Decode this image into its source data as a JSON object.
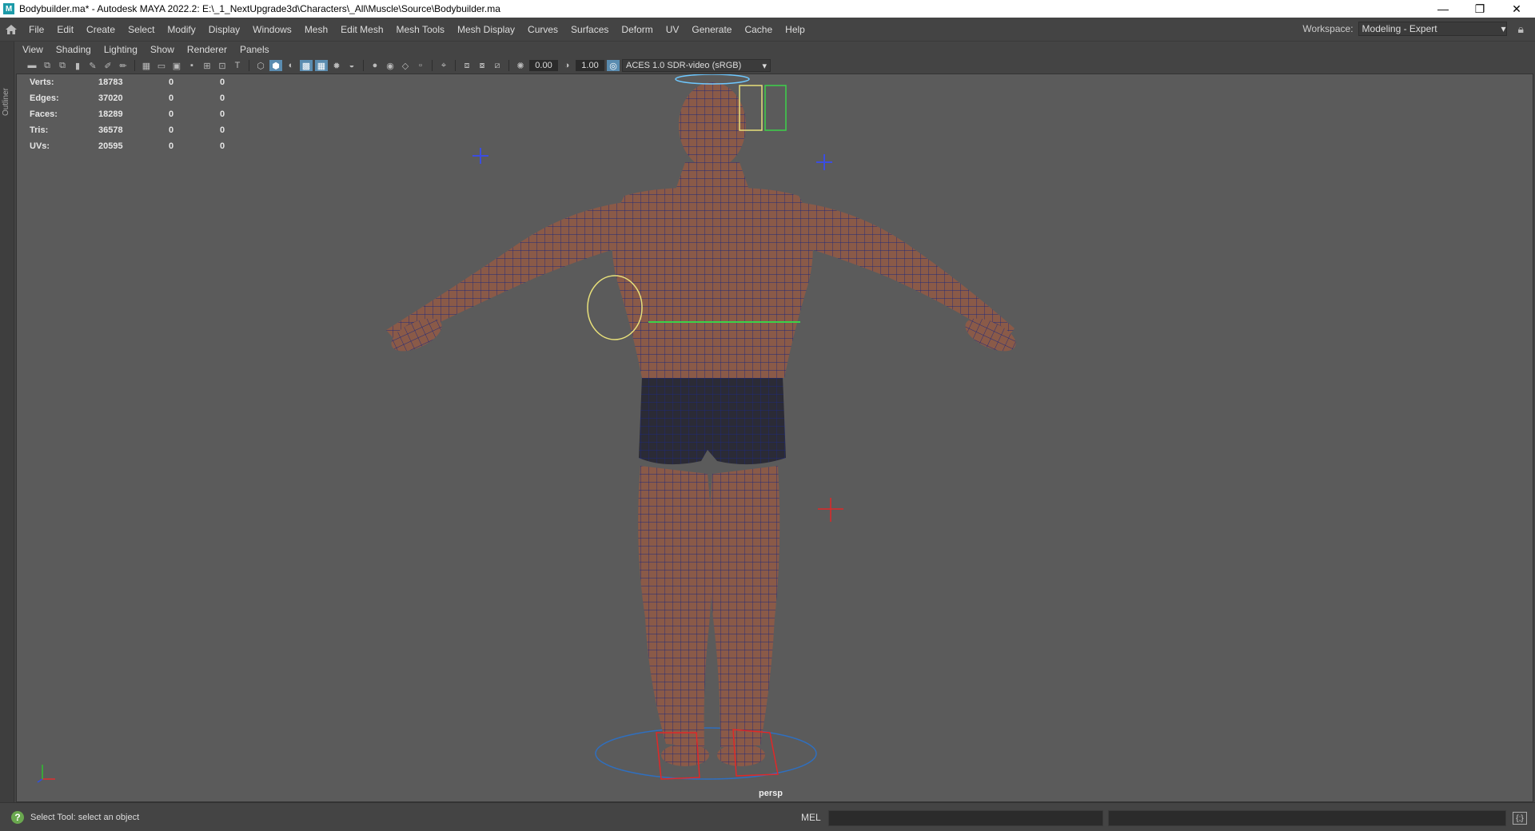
{
  "window": {
    "title": "Bodybuilder.ma* - Autodesk MAYA 2022.2: E:\\_1_NextUpgrade3d\\Characters\\_All\\Muscle\\Source\\Bodybuilder.ma",
    "app_icon": "M",
    "minimize": "—",
    "restore": "❐",
    "close": "✕"
  },
  "menubar": {
    "home_icon": "home-icon",
    "items": [
      "File",
      "Edit",
      "Create",
      "Select",
      "Modify",
      "Display",
      "Windows",
      "Mesh",
      "Edit Mesh",
      "Mesh Tools",
      "Mesh Display",
      "Curves",
      "Surfaces",
      "Deform",
      "UV",
      "Generate",
      "Cache",
      "Help"
    ]
  },
  "workspace": {
    "label": "Workspace:",
    "value": "Modeling - Expert"
  },
  "outliner": {
    "label": "Outliner"
  },
  "panel_menu": [
    "View",
    "Shading",
    "Lighting",
    "Show",
    "Renderer",
    "Panels"
  ],
  "panel_toolbar": {
    "exposure": "0.00",
    "gamma": "1.00",
    "color_space": "ACES 1.0 SDR-video (sRGB)"
  },
  "hud": {
    "rows": [
      {
        "label": "Verts:",
        "v1": "18783",
        "v2": "0",
        "v3": "0"
      },
      {
        "label": "Edges:",
        "v1": "37020",
        "v2": "0",
        "v3": "0"
      },
      {
        "label": "Faces:",
        "v1": "18289",
        "v2": "0",
        "v3": "0"
      },
      {
        "label": "Tris:",
        "v1": "36578",
        "v2": "0",
        "v3": "0"
      },
      {
        "label": "UVs:",
        "v1": "20595",
        "v2": "0",
        "v3": "0"
      }
    ]
  },
  "camera": {
    "name": "persp"
  },
  "statusbar": {
    "help_text": "Select Tool: select an object",
    "mel_label": "MEL"
  }
}
